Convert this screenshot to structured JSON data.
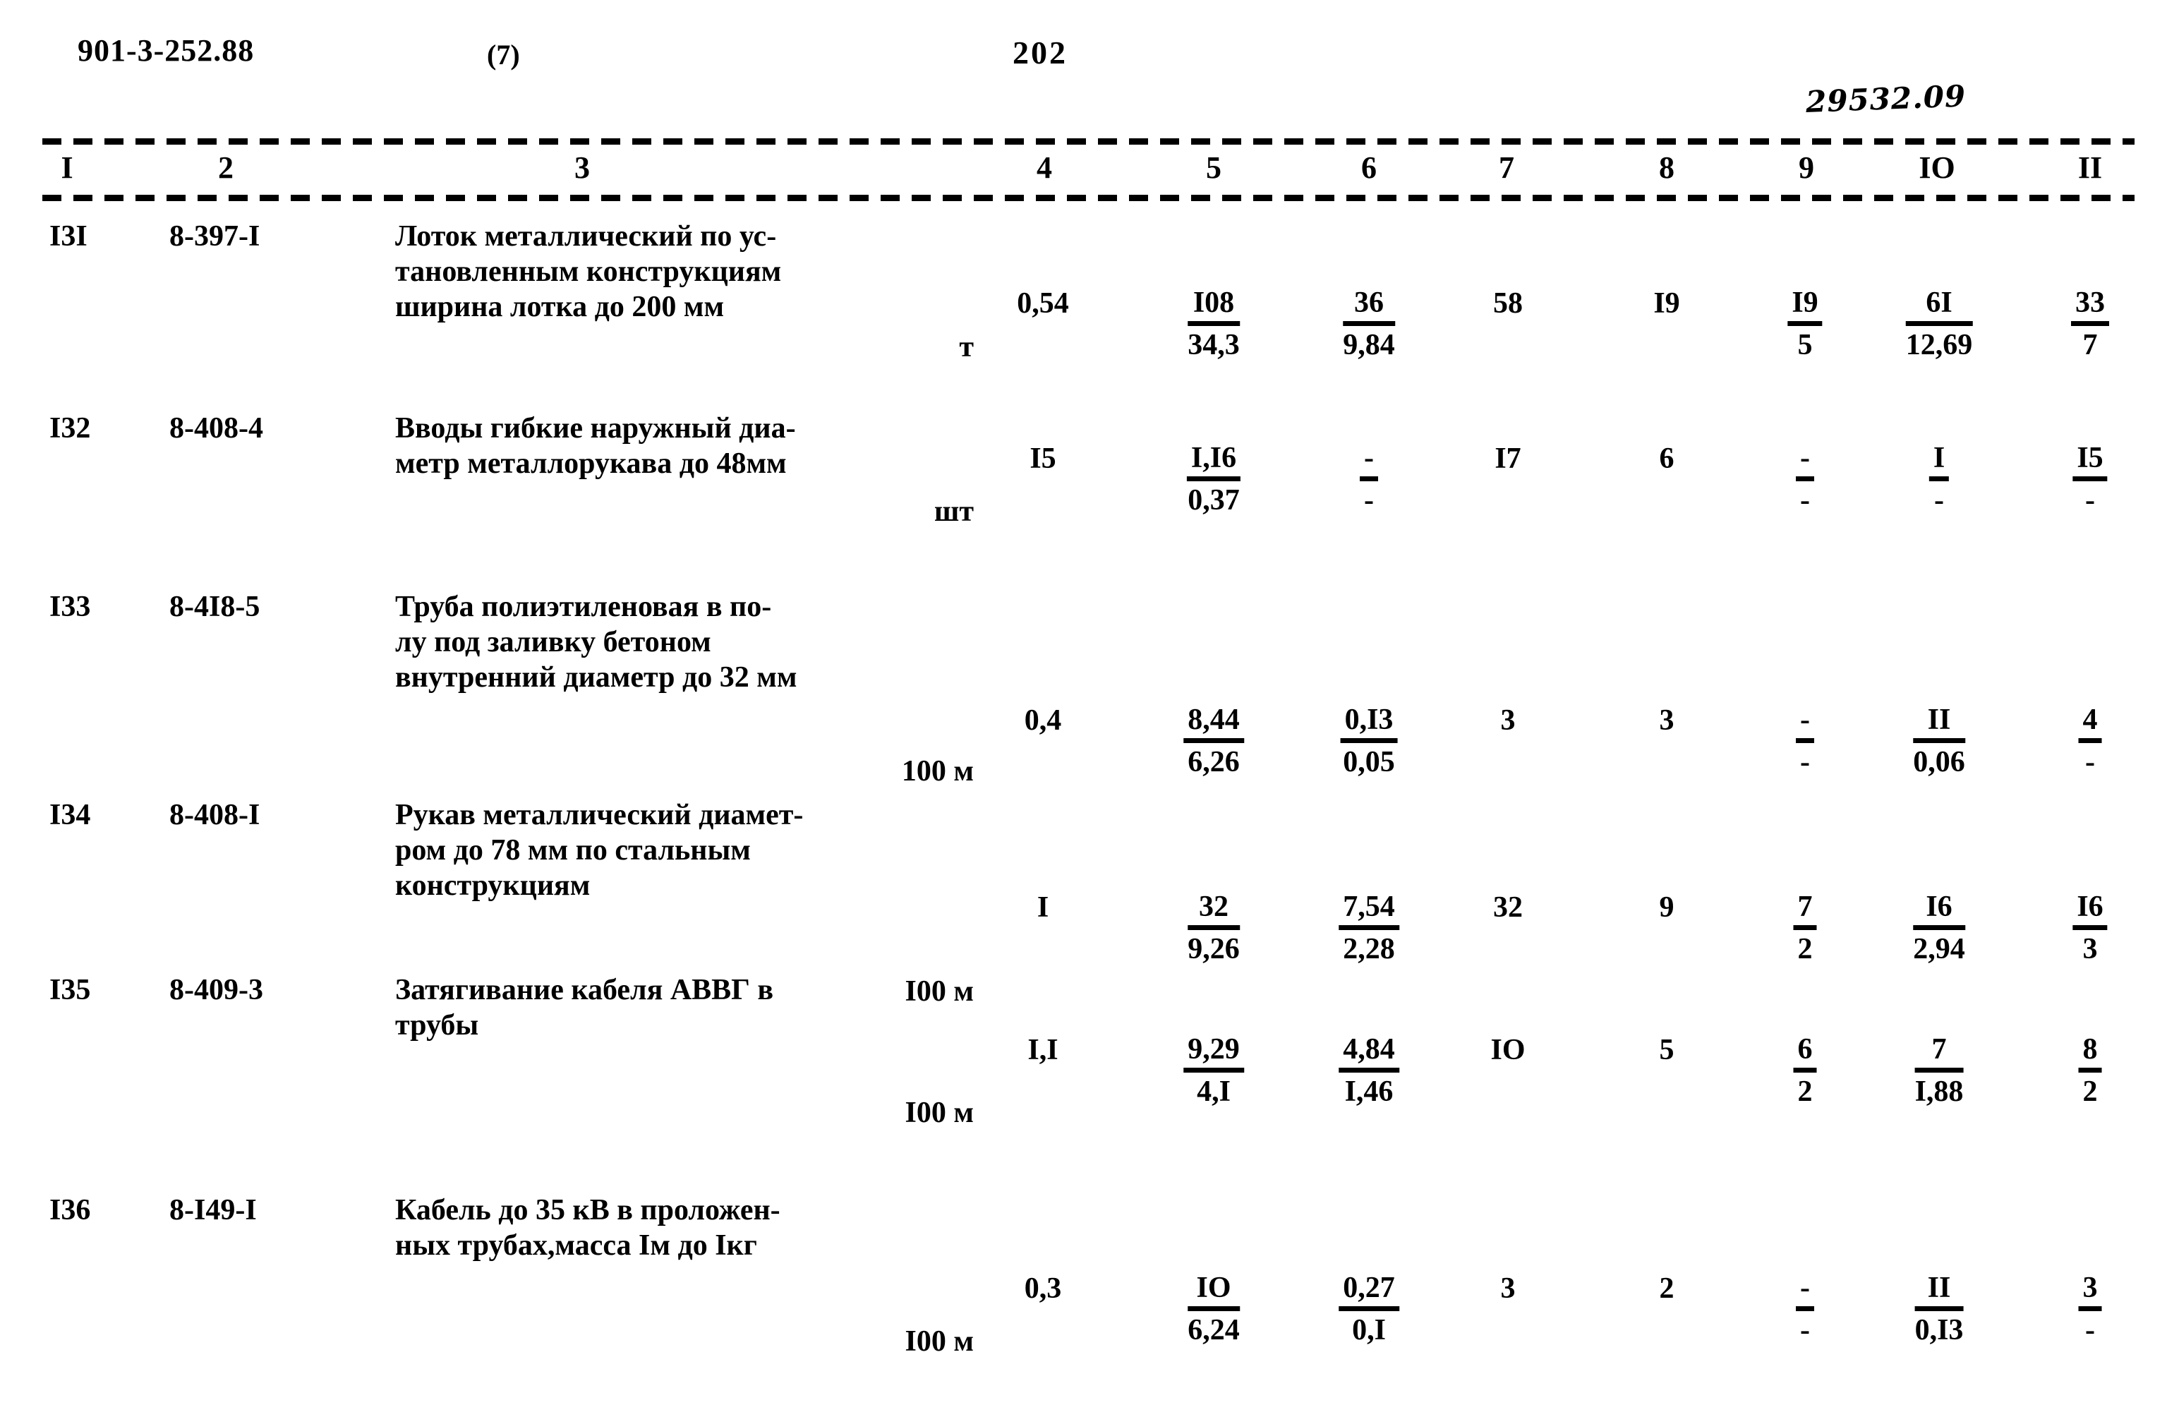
{
  "header": {
    "doc_code": "901-3-252.88",
    "sheet_no": "(7)",
    "page_number": "202",
    "hand_note": "29532.09"
  },
  "table": {
    "column_headers": [
      "I",
      "2",
      "3",
      "4",
      "5",
      "6",
      "7",
      "8",
      "9",
      "IO",
      "II"
    ],
    "rows": [
      {
        "no": "I3I",
        "code": "8-397-I",
        "desc_lines": [
          "Лоток металлический по ус-",
          "тановленным конструкциям",
          "ширина лотка до 200 мм"
        ],
        "unit": "т",
        "c4": "0,54",
        "c5_top": "I08",
        "c5_bot": "34,3",
        "c6_top": "36",
        "c6_bot": "9,84",
        "c7": "58",
        "c8": "I9",
        "c9_top": "I9",
        "c9_bot": "5",
        "c10_top": "6I",
        "c10_bot": "12,69",
        "c11_top": "33",
        "c11_bot": "7"
      },
      {
        "no": "I32",
        "code": "8-408-4",
        "desc_lines": [
          "Вводы гибкие наружный диа-",
          "метр металлорукава до 48мм"
        ],
        "unit": "шт",
        "c4": "I5",
        "c5_top": "I,I6",
        "c5_bot": "0,37",
        "c6_top": "-",
        "c6_bot": "-",
        "c7": "I7",
        "c8": "6",
        "c9_top": "-",
        "c9_bot": "-",
        "c10_top": "I",
        "c10_bot": "-",
        "c11_top": "I5",
        "c11_bot": "-"
      },
      {
        "no": "I33",
        "code": "8-4I8-5",
        "desc_lines": [
          "Труба полиэтиленовая в по-",
          "лу под заливку бетоном",
          "внутренний диаметр до 32 мм"
        ],
        "unit": "100 м",
        "c4": "0,4",
        "c5_top": "8,44",
        "c5_bot": "6,26",
        "c6_top": "0,I3",
        "c6_bot": "0,05",
        "c7": "3",
        "c8": "3",
        "c9_top": "-",
        "c9_bot": "-",
        "c10_top": "II",
        "c10_bot": "0,06",
        "c11_top": "4",
        "c11_bot": "-"
      },
      {
        "no": "I34",
        "code": "8-408-I",
        "desc_lines": [
          "Рукав металлический диамет-",
          "ром до 78 мм по стальным",
          "конструкциям"
        ],
        "unit": "I00 м",
        "c4": "I",
        "c5_top": "32",
        "c5_bot": "9,26",
        "c6_top": "7,54",
        "c6_bot": "2,28",
        "c7": "32",
        "c8": "9",
        "c9_top": "7",
        "c9_bot": "2",
        "c10_top": "I6",
        "c10_bot": "2,94",
        "c11_top": "I6",
        "c11_bot": "3"
      },
      {
        "no": "I35",
        "code": "8-409-3",
        "desc_lines": [
          "Затягивание кабеля АВВГ в",
          "трубы"
        ],
        "unit": "I00 м",
        "c4": "I,I",
        "c5_top": "9,29",
        "c5_bot": "4,I",
        "c6_top": "4,84",
        "c6_bot": "I,46",
        "c7": "IO",
        "c8": "5",
        "c9_top": "6",
        "c9_bot": "2",
        "c10_top": "7",
        "c10_bot": "I,88",
        "c11_top": "8",
        "c11_bot": "2"
      },
      {
        "no": "I36",
        "code": "8-I49-I",
        "desc_lines": [
          "Кабель до 35 кВ в проложен-",
          "ных трубах,масса Iм до Iкг"
        ],
        "unit": "I00 м",
        "c4": "0,3",
        "c5_top": "IO",
        "c5_bot": "6,24",
        "c6_top": "0,27",
        "c6_bot": "0,I",
        "c7": "3",
        "c8": "2",
        "c9_top": "-",
        "c9_bot": "-",
        "c10_top": "II",
        "c10_bot": "0,I3",
        "c11_top": "3",
        "c11_bot": "-"
      }
    ]
  },
  "layout": {
    "col_centers": [
      100,
      325,
      0,
      1477,
      1718,
      1940,
      2135,
      2360,
      2555,
      2745,
      2960
    ],
    "row_tops": [
      20,
      290,
      540,
      830,
      1080,
      1390
    ],
    "desc_top_offsets": [
      0,
      0,
      0,
      0,
      0,
      0
    ]
  }
}
